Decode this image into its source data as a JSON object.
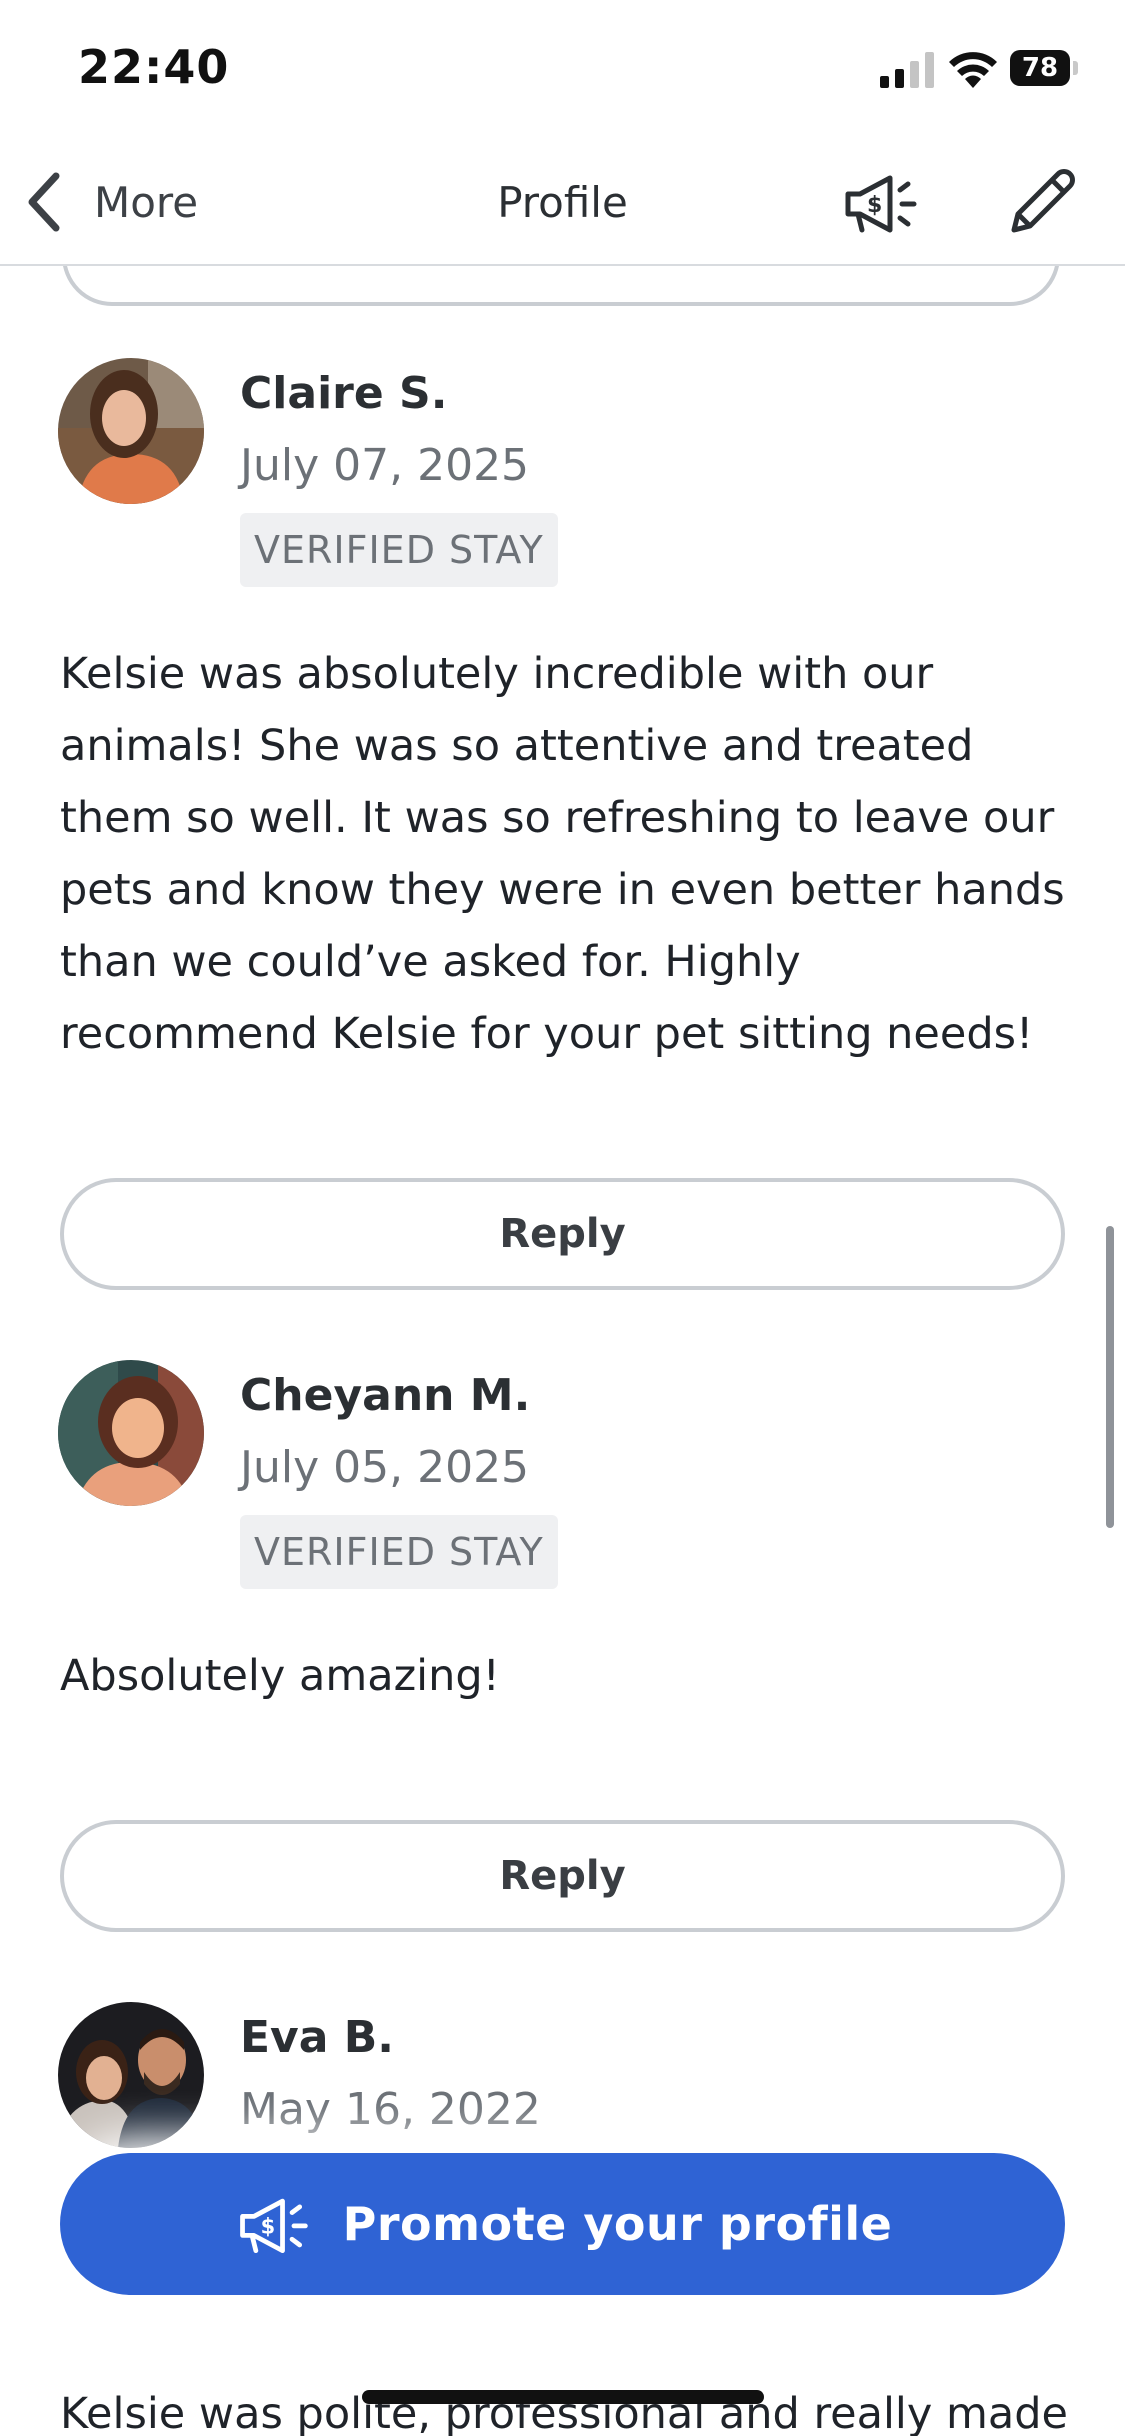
{
  "status_bar": {
    "time": "22:40",
    "battery_level": "78"
  },
  "nav": {
    "back_label": "More",
    "title": "Profile",
    "promote_icon": "megaphone-dollar-icon",
    "edit_icon": "pencil-icon"
  },
  "reviews": [
    {
      "name": "Claire S.",
      "date": "July 07, 2025",
      "badge": "VERIFIED STAY",
      "text": "Kelsie was absolutely incredible with our animals! She was so attentive and treated them so well. It was so refreshing to leave our pets and know they were in even better hands than we could’ve asked for. Highly recommend Kelsie for your pet sitting needs!",
      "reply_label": "Reply"
    },
    {
      "name": "Cheyann M.",
      "date": "July 05, 2025",
      "badge": "VERIFIED STAY",
      "text": "Absolutely amazing!",
      "reply_label": "Reply"
    },
    {
      "name": "Eva B.",
      "date": "May 16, 2022",
      "text": "Kelsie was polite, professional and really made"
    }
  ],
  "promote_button": {
    "label": "Promote your profile"
  },
  "colors": {
    "accent": "#2f63d4",
    "badge_bg": "#eff0f2",
    "border": "#c9cdd2"
  }
}
